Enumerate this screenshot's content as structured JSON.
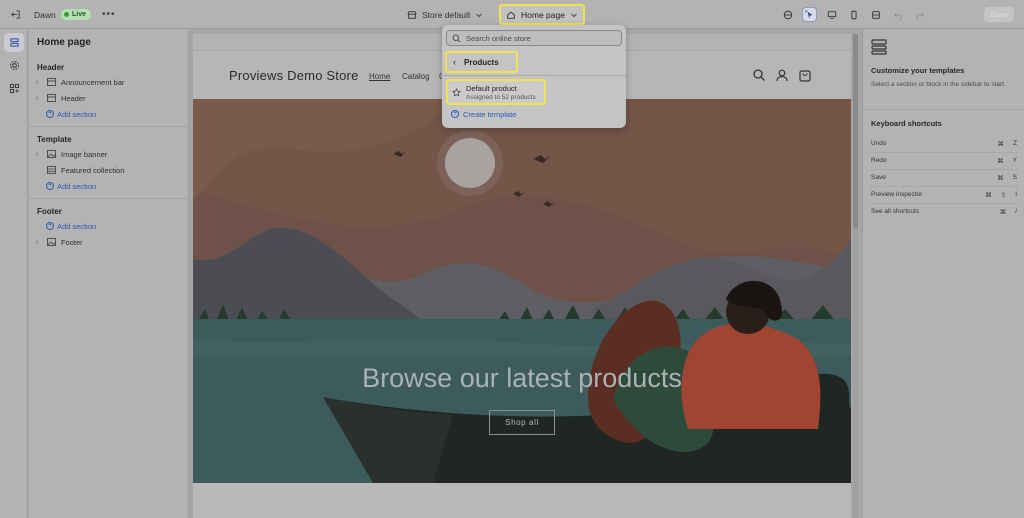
{
  "topbar": {
    "theme_name": "Dawn",
    "live_label": "Live",
    "more_label": "•••",
    "store_select": "Store default",
    "page_select": "Home page",
    "save_label": "Save"
  },
  "sidebar": {
    "title": "Home page",
    "groups": {
      "header": "Header",
      "template": "Template",
      "footer": "Footer"
    },
    "items": {
      "announcement_bar": "Announcement bar",
      "header": "Header",
      "add_section_header": "Add section",
      "image_banner": "Image banner",
      "featured_collection": "Featured collection",
      "add_section_template": "Add section",
      "add_section_footer": "Add section",
      "footer": "Footer"
    }
  },
  "preview": {
    "store_name": "Proviews Demo Store",
    "nav": [
      "Home",
      "Catalog",
      "C"
    ],
    "hero_heading": "Browse our latest products",
    "hero_button": "Shop all"
  },
  "dropdown": {
    "search_placeholder": "Search online store",
    "back_label": "Products",
    "template_name": "Default product",
    "template_sub": "Assigned to 52 products",
    "create_label": "Create template"
  },
  "right_panel": {
    "title": "Customize your templates",
    "description": "Select a section or block in the sidebar to start.",
    "shortcuts_title": "Keyboard shortcuts",
    "shortcuts": [
      {
        "label": "Undo",
        "keys": [
          "⌘",
          "Z"
        ]
      },
      {
        "label": "Redo",
        "keys": [
          "⌘",
          "Y"
        ]
      },
      {
        "label": "Save",
        "keys": [
          "⌘",
          "S"
        ]
      },
      {
        "label": "Preview inspector",
        "keys": [
          "⌘",
          "⇧",
          "I"
        ]
      },
      {
        "label": "See all shortcuts",
        "keys": [
          "⌘",
          "/"
        ]
      }
    ]
  },
  "colors": {
    "highlight": "#f3e24d",
    "link_blue": "#2a5bb5",
    "live_green": "#3f9b3a"
  }
}
